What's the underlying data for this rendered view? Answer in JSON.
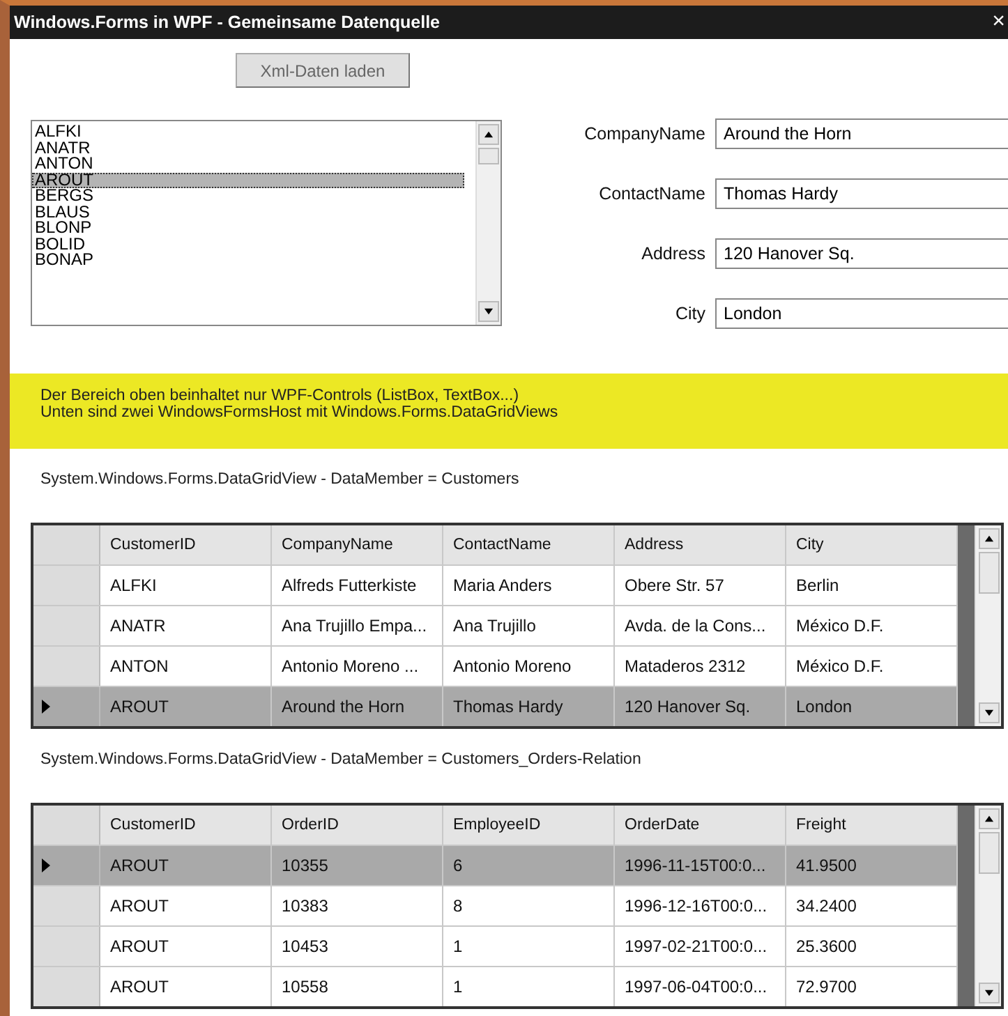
{
  "window": {
    "title": "Windows.Forms in WPF - Gemeinsame Datenquelle",
    "close": "×"
  },
  "load_button": {
    "label": "Xml-Daten laden"
  },
  "customer_list": {
    "items": [
      {
        "label": "ALFKI",
        "selected": false
      },
      {
        "label": "ANATR",
        "selected": false
      },
      {
        "label": "ANTON",
        "selected": false
      },
      {
        "label": "AROUT",
        "selected": true
      },
      {
        "label": "BERGS",
        "selected": false
      },
      {
        "label": "BLAUS",
        "selected": false
      },
      {
        "label": "BLONP",
        "selected": false
      },
      {
        "label": "BOLID",
        "selected": false
      },
      {
        "label": "BONAP",
        "selected": false
      }
    ]
  },
  "fields": [
    {
      "label": "CompanyName",
      "value": "Around the Horn"
    },
    {
      "label": "ContactName",
      "value": "Thomas Hardy"
    },
    {
      "label": "Address",
      "value": "120 Hanover Sq."
    },
    {
      "label": "City",
      "value": "London"
    }
  ],
  "banner": {
    "lines": [
      "Der Bereich oben beinhaltet nur WPF-Controls (ListBox, TextBox...)",
      "Unten sind zwei WindowsFormsHost mit Windows.Forms.DataGridViews"
    ]
  },
  "grids": [
    {
      "caption": "System.Windows.Forms.DataGridView - DataMember = Customers",
      "columns": [
        "CustomerID",
        "CompanyName",
        "ContactName",
        "Address",
        "City"
      ],
      "rows": [
        {
          "selected": false,
          "cells": [
            "ALFKI",
            "Alfreds Futterkiste",
            "Maria Anders",
            "Obere Str. 57",
            "Berlin"
          ]
        },
        {
          "selected": false,
          "cells": [
            "ANATR",
            "Ana Trujillo Empa...",
            "Ana Trujillo",
            "Avda. de la Cons...",
            "México D.F."
          ]
        },
        {
          "selected": false,
          "cells": [
            "ANTON",
            "Antonio Moreno ...",
            "Antonio Moreno",
            "Mataderos  2312",
            "México D.F."
          ]
        },
        {
          "selected": true,
          "cells": [
            "AROUT",
            "Around the Horn",
            "Thomas Hardy",
            "120 Hanover Sq.",
            "London"
          ]
        }
      ]
    },
    {
      "caption": "System.Windows.Forms.DataGridView - DataMember = Customers_Orders-Relation",
      "columns": [
        "CustomerID",
        "OrderID",
        "EmployeeID",
        "OrderDate",
        "Freight"
      ],
      "rows": [
        {
          "selected": true,
          "cells": [
            "AROUT",
            "10355",
            "6",
            "1996-11-15T00:0...",
            "41.9500"
          ]
        },
        {
          "selected": false,
          "cells": [
            "AROUT",
            "10383",
            "8",
            "1996-12-16T00:0...",
            "34.2400"
          ]
        },
        {
          "selected": false,
          "cells": [
            "AROUT",
            "10453",
            "1",
            "1997-02-21T00:0...",
            "25.3600"
          ]
        },
        {
          "selected": false,
          "cells": [
            "AROUT",
            "10558",
            "1",
            "1997-06-04T00:0...",
            "72.9700"
          ]
        }
      ]
    }
  ]
}
